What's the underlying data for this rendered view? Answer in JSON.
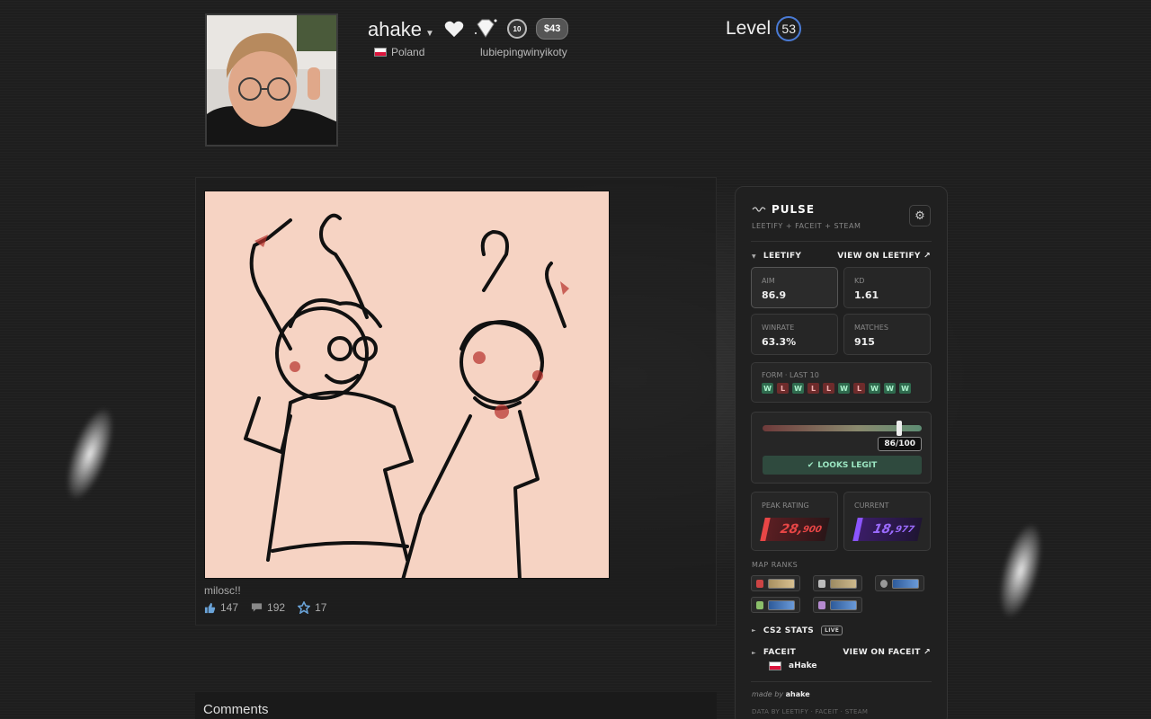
{
  "profile": {
    "persona_name": "ahake",
    "country": "Poland",
    "real_name": "lubiepingwinyikoty",
    "money_badge": "$43",
    "years_badge": "10",
    "level_label": "Level",
    "level": "53"
  },
  "showcase": {
    "artwork_title": "milosc!!",
    "likes": "147",
    "comments": "192",
    "awards": "17"
  },
  "comments_section": {
    "title": "Comments"
  },
  "pulse": {
    "title": "PULSE",
    "subtitle": "LEETIFY + FACEIT + STEAM",
    "leetify": {
      "label": "LEETIFY",
      "link": "VIEW ON LEETIFY ↗",
      "aim_label": "AIM",
      "aim": "86.9",
      "kd_label": "KD",
      "kd": "1.61",
      "winrate_label": "WINRATE",
      "winrate": "63.3%",
      "matches_label": "MATCHES",
      "matches": "915",
      "form_label": "FORM · LAST 10",
      "form": [
        "W",
        "L",
        "W",
        "L",
        "L",
        "W",
        "L",
        "W",
        "W",
        "W"
      ]
    },
    "legit": {
      "score": "86/100",
      "score_value": 86,
      "verdict": "LOOKS LEGIT"
    },
    "ratings": {
      "peak_label": "PEAK RATING",
      "peak_major": "28,",
      "peak_minor": "900",
      "current_label": "CURRENT",
      "current_major": "18,",
      "current_minor": "977"
    },
    "map_ranks_label": "MAP RANKS",
    "cs2_label": "CS2 STATS",
    "live_badge": "LIVE",
    "faceit": {
      "label": "FACEIT",
      "link": "VIEW ON FACEIT ↗",
      "user": "aHake"
    },
    "made_by_prefix": "made by",
    "made_by": "ahake",
    "data_by": "DATA BY LEETIFY · FACEIT · STEAM"
  },
  "colors": {
    "accent_blue": "#4a7bd6",
    "win": "#2f6b4e",
    "loss": "#6e2b2b",
    "peak": "#e84646",
    "current": "#8b55ff"
  }
}
